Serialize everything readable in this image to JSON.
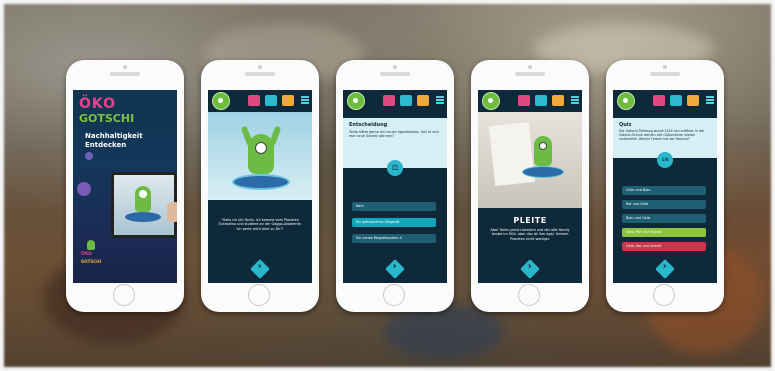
{
  "phones": [
    {
      "id": "title",
      "logo_top": "ÖKO",
      "logo_bottom": "GOTSCHI",
      "tagline_1": "Nachhaltigkeit",
      "tagline_2": "Entdecken",
      "small_logo_1": "ÖKO",
      "small_logo_2": "GOTSCHI"
    },
    {
      "id": "intro",
      "speech": "\"Hallo ich bin Tonfo. Ich komme vom Planeten Öckkodino und studiere an der Gagga-Akademie. Ich perte mich jetzt zu Dir!\""
    },
    {
      "id": "decision",
      "title": "Entscheidung",
      "question": "Tonfo hätte gerne ein neues Irgendetwas. Soll er sich mal neue Socken gönnen?",
      "answers": [
        "Nein",
        "Ein gebrauchtes Ufogerät",
        "Ein neues Magnetsystem 4"
      ]
    },
    {
      "id": "pleite",
      "banner": "PLEITE",
      "text": "Aber Tonfo grinst trotzdem und der alte Handy landet im Müll, aber das ist ihm egal. Seinem Planeten nicht weniger."
    },
    {
      "id": "quiz",
      "title": "Quiz",
      "question": "Der Gotschi-Tüteburg wurde 2016 neu eröffnet. In der Gotschi-Schule werden alle Gütezeichen wieder vorbereitet. Welche Farben hat der Recycle?",
      "progress": "1/6",
      "answers": [
        "Grün und Blau",
        "Rot und Gelb",
        "Blau und Gelb",
        "Gelb, Rot und Violett",
        "Gelb, Rot und Violett"
      ]
    }
  ],
  "icons": [
    "avatar-icon",
    "sad-face-icon",
    "happy-face-icon",
    "folder-icon",
    "menu-icon",
    "next-arrow-icon"
  ],
  "colors": {
    "dark_navy": "#0e2a3a",
    "cyan": "#29b7cc",
    "answer_teal": "#1f5f73",
    "highlight_teal": "#14a6b8",
    "answer_green": "#8bc43f",
    "answer_red": "#d2334a"
  }
}
